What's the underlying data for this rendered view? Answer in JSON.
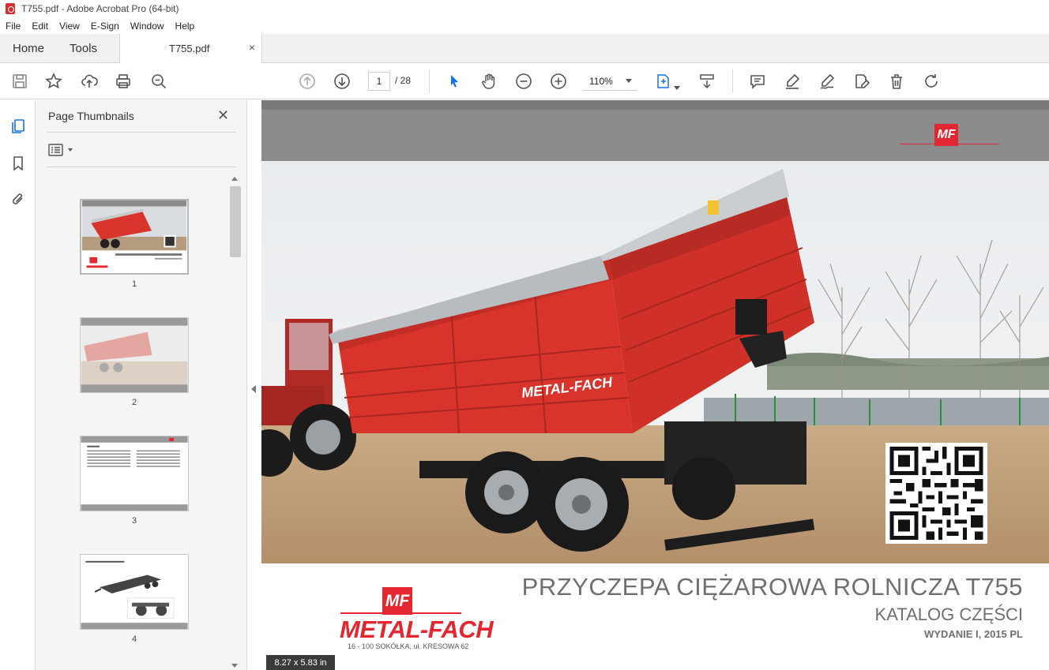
{
  "window": {
    "title": "T755.pdf - Adobe Acrobat Pro (64-bit)"
  },
  "menu": [
    "File",
    "Edit",
    "View",
    "E-Sign",
    "Window",
    "Help"
  ],
  "tabs": {
    "home": "Home",
    "tools": "Tools",
    "document": "T755.pdf",
    "close": "×"
  },
  "toolbar": {
    "current_page": "1",
    "total_pages": "/ 28",
    "zoom": "110%",
    "icons": [
      "save-icon",
      "star-icon",
      "upload-icon",
      "print-icon",
      "zoom-search-icon",
      "page-up-icon",
      "page-down-icon",
      "select-cursor-icon",
      "hand-icon",
      "zoom-out-icon",
      "zoom-in-icon",
      "fit-page-icon",
      "scroll-mode-icon",
      "comment-icon",
      "highlight-icon",
      "sign-icon",
      "edit-pdf-icon",
      "delete-icon",
      "rotate-icon"
    ]
  },
  "panel": {
    "title": "Page Thumbnails",
    "close": "✕",
    "thumbnails": [
      {
        "number": "1"
      },
      {
        "number": "2"
      },
      {
        "number": "3"
      },
      {
        "number": "4"
      }
    ]
  },
  "document": {
    "title": "PRZYCZEPA CIĘŻAROWA ROLNICZA T755",
    "subtitle": "KATALOG CZĘŚCI",
    "edition": "WYDANIE I, 2015 PL",
    "logo_mark": "MF",
    "logo_text": "METAL-FACH",
    "address": "16 - 100 SOKÓŁKA, ul. KRESOWA 62",
    "trailer_brand": "METAL-FACH",
    "page_size": "8.27 x 5.83 in"
  },
  "colors": {
    "brand_red": "#e3262f",
    "header_gray": "#8c8c8c",
    "trailer_red": "#d9342b"
  }
}
